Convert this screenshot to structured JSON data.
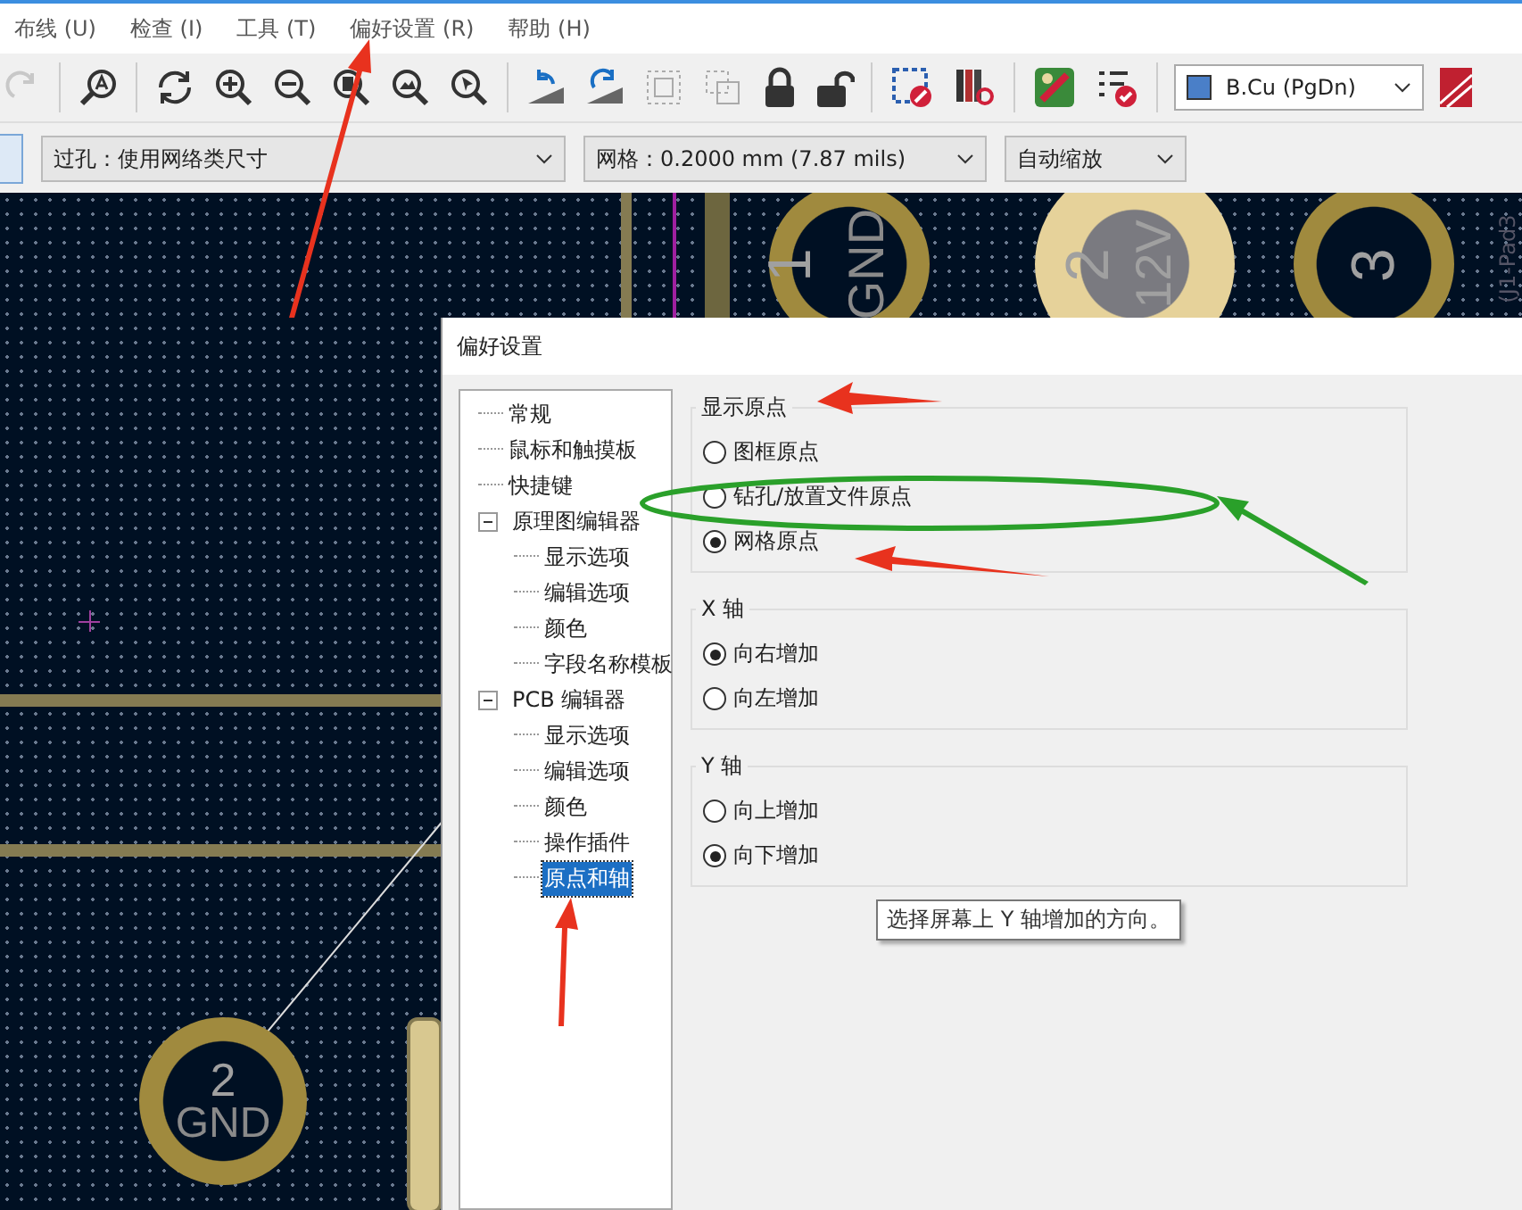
{
  "menu": [
    {
      "label": "布线 (U)"
    },
    {
      "label": "检查 (I)"
    },
    {
      "label": "工具 (T)"
    },
    {
      "label": "偏好设置 (R)"
    },
    {
      "label": "帮助 (H)"
    }
  ],
  "layer_select": {
    "value": "B.Cu (PgDn)",
    "color": "#4a7fc8"
  },
  "via_select": {
    "value": "过孔：使用网络类尺寸"
  },
  "grid_select": {
    "value": "网格：0.2000 mm (7.87 mils)"
  },
  "zoom_select": {
    "value": "自动缩放"
  },
  "pads": [
    {
      "number": "1",
      "net": "GND",
      "kind": "dark"
    },
    {
      "number": "2",
      "net": "12V",
      "kind": "light"
    },
    {
      "number": "3",
      "kind": "dark"
    },
    {
      "number": "2",
      "net": "GND",
      "kind": "dark"
    }
  ],
  "pad_reference": "(J1-Pad3",
  "dialog": {
    "title": "偏好设置",
    "tree": [
      {
        "label": "常规",
        "selected": false
      },
      {
        "label": "鼠标和触摸板",
        "selected": false
      },
      {
        "label": "快捷键",
        "selected": false
      },
      {
        "label": "原理图编辑器",
        "selected": false,
        "expanded": true,
        "children": [
          {
            "label": "显示选项",
            "selected": false
          },
          {
            "label": "编辑选项",
            "selected": false
          },
          {
            "label": "颜色",
            "selected": false
          },
          {
            "label": "字段名称模板",
            "selected": false
          }
        ]
      },
      {
        "label": "PCB 编辑器",
        "selected": false,
        "expanded": true,
        "children": [
          {
            "label": "显示选项",
            "selected": false
          },
          {
            "label": "编辑选项",
            "selected": false
          },
          {
            "label": "颜色",
            "selected": false
          },
          {
            "label": "操作插件",
            "selected": false
          },
          {
            "label": "原点和轴",
            "selected": true
          }
        ]
      }
    ],
    "groups": [
      {
        "title": "显示原点",
        "options": [
          {
            "label": "图框原点",
            "selected": false
          },
          {
            "label": "钻孔/放置文件原点",
            "selected": false
          },
          {
            "label": "网格原点",
            "selected": true
          }
        ]
      },
      {
        "title": "X 轴",
        "options": [
          {
            "label": "向右增加",
            "selected": true
          },
          {
            "label": "向左增加",
            "selected": false
          }
        ]
      },
      {
        "title": "Y 轴",
        "options": [
          {
            "label": "向上增加",
            "selected": false
          },
          {
            "label": "向下增加",
            "selected": true
          }
        ]
      }
    ],
    "tooltip": "选择屏幕上 Y 轴增加的方向。"
  }
}
